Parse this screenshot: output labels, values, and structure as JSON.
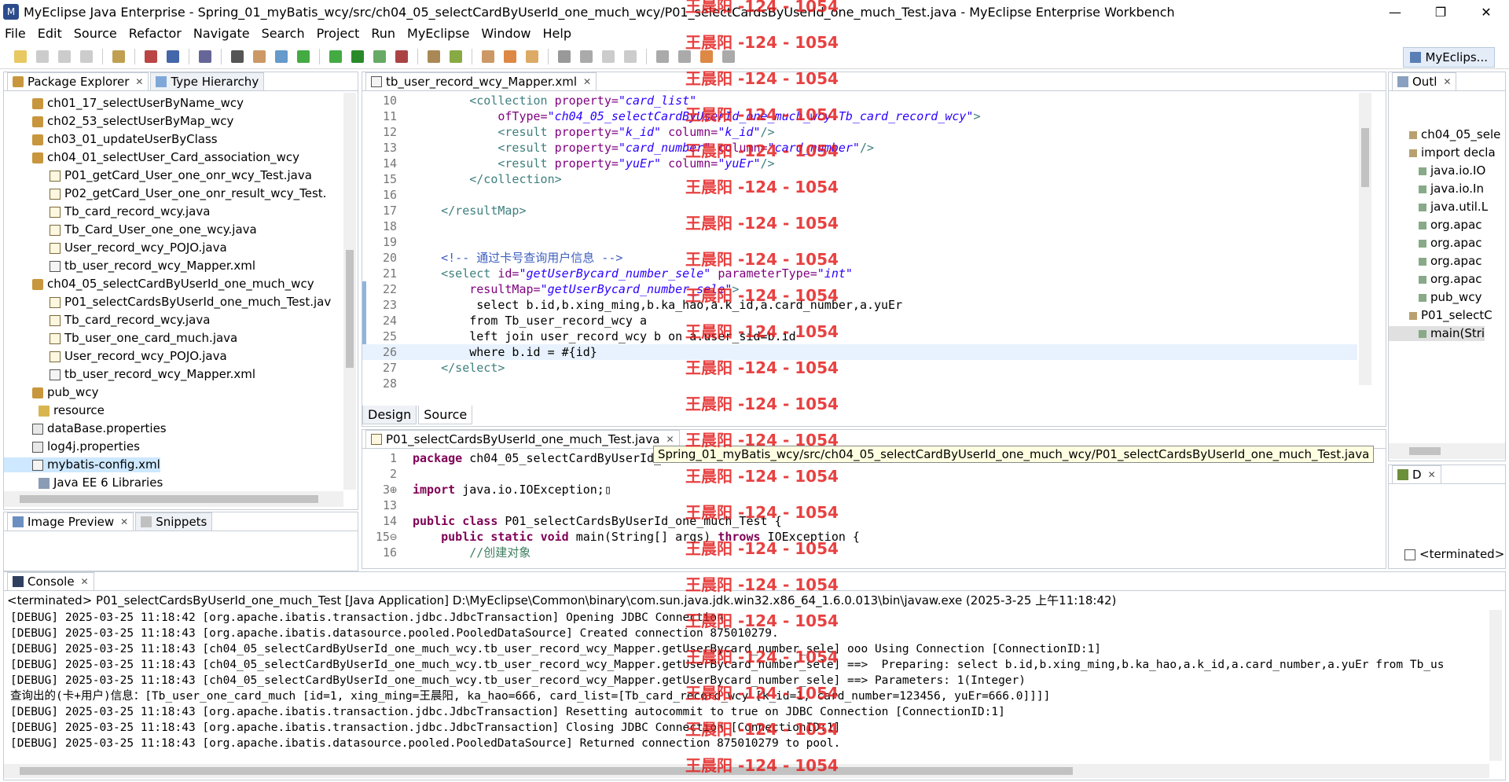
{
  "window": {
    "title": "MyEclipse Java Enterprise - Spring_01_myBatis_wcy/src/ch04_05_selectCardByUserId_one_much_wcy/P01_selectCardsByUserId_one_much_Test.java - MyEclipse Enterprise Workbench",
    "minimize": "—",
    "restore": "❐",
    "close": "✕"
  },
  "menu": [
    "File",
    "Edit",
    "Source",
    "Refactor",
    "Navigate",
    "Search",
    "Project",
    "Run",
    "MyEclipse",
    "Window",
    "Help"
  ],
  "perspective": "MyEclips...",
  "package_explorer": {
    "tab": "Package Explorer",
    "tab2": "Type Hierarchy",
    "items": [
      {
        "label": "ch01_17_selectUserByName_wcy",
        "type": "pkg",
        "indent": 1
      },
      {
        "label": "ch02_53_selectUserByMap_wcy",
        "type": "pkg",
        "indent": 1
      },
      {
        "label": "ch03_01_updateUserByClass",
        "type": "pkg",
        "indent": 1
      },
      {
        "label": "ch04_01_selectUser_Card_association_wcy",
        "type": "pkg",
        "indent": 1
      },
      {
        "label": "P01_getCard_User_one_onr_wcy_Test.java",
        "type": "java",
        "indent": 2
      },
      {
        "label": "P02_getCard_User_one_onr_result_wcy_Test.",
        "type": "java",
        "indent": 2
      },
      {
        "label": "Tb_card_record_wcy.java",
        "type": "java",
        "indent": 2
      },
      {
        "label": "Tb_Card_User_one_one_wcy.java",
        "type": "java",
        "indent": 2
      },
      {
        "label": "User_record_wcy_POJO.java",
        "type": "java",
        "indent": 2
      },
      {
        "label": "tb_user_record_wcy_Mapper.xml",
        "type": "xml",
        "indent": 2
      },
      {
        "label": "ch04_05_selectCardByUserId_one_much_wcy",
        "type": "pkg",
        "indent": 1
      },
      {
        "label": "P01_selectCardsByUserId_one_much_Test.jav",
        "type": "java",
        "indent": 2
      },
      {
        "label": "Tb_card_record_wcy.java",
        "type": "java",
        "indent": 2
      },
      {
        "label": "Tb_user_one_card_much.java",
        "type": "java",
        "indent": 2
      },
      {
        "label": "User_record_wcy_POJO.java",
        "type": "java",
        "indent": 2
      },
      {
        "label": "tb_user_record_wcy_Mapper.xml",
        "type": "xml",
        "indent": 2
      },
      {
        "label": "pub_wcy",
        "type": "pkg",
        "indent": 1
      },
      {
        "label": "resource",
        "type": "folder",
        "indent": 0
      },
      {
        "label": "dataBase.properties",
        "type": "prop",
        "indent": 1
      },
      {
        "label": "log4j.properties",
        "type": "prop",
        "indent": 1
      },
      {
        "label": "mybatis-config.xml",
        "type": "xml",
        "indent": 1,
        "selected": true
      },
      {
        "label": "Java EE 6 Libraries",
        "type": "lib",
        "indent": 0
      }
    ]
  },
  "image_preview": {
    "tab": "Image Preview",
    "tab2": "Snippets"
  },
  "xml_editor": {
    "tab": "tb_user_record_wcy_Mapper.xml",
    "bottom_tabs": [
      "Design",
      "Source"
    ],
    "lines": [
      {
        "n": "10",
        "html": "        <span class='tag'>&lt;collection</span> <span class='attr'>property=</span><span class='str'>\"card_list\"</span>"
      },
      {
        "n": "11",
        "html": "            <span class='attr'>ofType=</span><span class='str'>\"ch04_05_selectCardByUserId_one_much_wcy.Tb_card_record_wcy\"</span><span class='tag'>&gt;</span>"
      },
      {
        "n": "12",
        "html": "            <span class='tag'>&lt;result</span> <span class='attr'>property=</span><span class='str'>\"k_id\"</span> <span class='attr'>column=</span><span class='str'>\"k_id\"</span><span class='tag'>/&gt;</span>"
      },
      {
        "n": "13",
        "html": "            <span class='tag'>&lt;result</span> <span class='attr'>property=</span><span class='str'>\"card_number\"</span> <span class='attr'>column=</span><span class='str'>\"card_number\"</span><span class='tag'>/&gt;</span>"
      },
      {
        "n": "14",
        "html": "            <span class='tag'>&lt;result</span> <span class='attr'>property=</span><span class='str'>\"yuEr\"</span> <span class='attr'>column=</span><span class='str'>\"yuEr\"</span><span class='tag'>/&gt;</span>"
      },
      {
        "n": "15",
        "html": "        <span class='tag'>&lt;/collection&gt;</span>"
      },
      {
        "n": "16",
        "html": ""
      },
      {
        "n": "17",
        "html": "    <span class='tag'>&lt;/resultMap&gt;</span>"
      },
      {
        "n": "18",
        "html": ""
      },
      {
        "n": "19",
        "html": ""
      },
      {
        "n": "20",
        "html": "    <span class='cmt'>&lt;!-- 通过卡号查询用户信息 --&gt;</span>"
      },
      {
        "n": "21",
        "html": "    <span class='tag'>&lt;select</span> <span class='attr'>id=</span><span class='str'>\"getUserBycard_number_sele\"</span> <span class='attr'>parameterType=</span><span class='str'>\"int\"</span>"
      },
      {
        "n": "22",
        "html": "        <span class='attr'>resultMap=</span><span class='str'>\"getUserBycard_number_sele\"</span><span class='tag'>&gt;</span>"
      },
      {
        "n": "23",
        "html": "         select b.id,b.xing_ming,b.ka_hao,a.k_id,a.card_number,a.yuEr"
      },
      {
        "n": "24",
        "html": "        from Tb_user_record_wcy a"
      },
      {
        "n": "25",
        "html": "        left join user_record_wcy b on a.user_sid=b.id"
      },
      {
        "n": "26",
        "html": "        where b.id = #{id}"
      },
      {
        "n": "27",
        "html": "    <span class='tag'>&lt;/select&gt;</span>"
      },
      {
        "n": "28",
        "html": ""
      }
    ]
  },
  "java_editor": {
    "tab": "P01_selectCardsByUserId_one_much_Test.java",
    "tooltip": "Spring_01_myBatis_wcy/src/ch04_05_selectCardByUserId_one_much_wcy/P01_selectCardsByUserId_one_much_Test.java",
    "lines": [
      {
        "n": "1",
        "html": "<span class='kw'>package</span> ch04_05_selectCardByUserId_o"
      },
      {
        "n": "2",
        "html": ""
      },
      {
        "n": "3⊕",
        "html": "<span class='kw'>import</span> java.io.IOException;▯"
      },
      {
        "n": "13",
        "html": ""
      },
      {
        "n": "14",
        "html": "<span class='kw'>public</span> <span class='kw'>class</span> P01_selectCardsByUserId_one_much_Test {"
      },
      {
        "n": "15⊖",
        "html": "    <span class='kw'>public</span> <span class='kw'>static</span> <span class='kw'>void</span> main(String[] args) <span class='kw'>throws</span> IOException {"
      },
      {
        "n": "16",
        "html": "        <span class='gcmt'>//创建对象</span>"
      }
    ]
  },
  "outline": {
    "tab": "Outl",
    "items": [
      {
        "label": "ch04_05_sele",
        "indent": 1
      },
      {
        "label": "import decla",
        "indent": 1
      },
      {
        "label": "java.io.IO",
        "indent": 2
      },
      {
        "label": "java.io.In",
        "indent": 2
      },
      {
        "label": "java.util.L",
        "indent": 2
      },
      {
        "label": "org.apac",
        "indent": 2
      },
      {
        "label": "org.apac",
        "indent": 2
      },
      {
        "label": "org.apac",
        "indent": 2
      },
      {
        "label": "org.apac",
        "indent": 2
      },
      {
        "label": "pub_wcy",
        "indent": 2
      },
      {
        "label": "P01_selectC",
        "indent": 1
      },
      {
        "label": "main(Stri",
        "indent": 2
      }
    ]
  },
  "debug_panel": {
    "tab": "D",
    "terminated": "<terminated>"
  },
  "console": {
    "tab": "Console",
    "header": "<terminated> P01_selectCardsByUserId_one_much_Test [Java Application] D:\\MyEclipse\\Common\\binary\\com.sun.java.jdk.win32.x86_64_1.6.0.013\\bin\\javaw.exe (2025-3-25 上午11:18:42)",
    "lines": [
      "[DEBUG] 2025-03-25 11:18:42 [org.apache.ibatis.transaction.jdbc.JdbcTransaction] Opening JDBC Connection",
      "[DEBUG] 2025-03-25 11:18:43 [org.apache.ibatis.datasource.pooled.PooledDataSource] Created connection 875010279.",
      "[DEBUG] 2025-03-25 11:18:43 [ch04_05_selectCardByUserId_one_much_wcy.tb_user_record_wcy_Mapper.getUserBycard_number_sele] ooo Using Connection [ConnectionID:1]",
      "[DEBUG] 2025-03-25 11:18:43 [ch04_05_selectCardByUserId_one_much_wcy.tb_user_record_wcy_Mapper.getUserBycard_number_sele] ==>  Preparing: select b.id,b.xing_ming,b.ka_hao,a.k_id,a.card_number,a.yuEr from Tb_us",
      "[DEBUG] 2025-03-25 11:18:43 [ch04_05_selectCardByUserId_one_much_wcy.tb_user_record_wcy_Mapper.getUserBycard_number_sele] ==> Parameters: 1(Integer)",
      "查询出的(卡+用户)信息：[Tb_user_one_card_much [id=1, xing_ming=王晨阳, ka_hao=666, card_list=[Tb_card_record_wcy [k_id=1, card_number=123456, yuEr=666.0]]]]",
      "[DEBUG] 2025-03-25 11:18:43 [org.apache.ibatis.transaction.jdbc.JdbcTransaction] Resetting autocommit to true on JDBC Connection [ConnectionID:1]",
      "[DEBUG] 2025-03-25 11:18:43 [org.apache.ibatis.transaction.jdbc.JdbcTransaction] Closing JDBC Connection [ConnectionID:1]",
      "[DEBUG] 2025-03-25 11:18:43 [org.apache.ibatis.datasource.pooled.PooledDataSource] Returned connection 875010279 to pool."
    ]
  },
  "watermark": "王晨阳 -124 - 1054",
  "colors": {
    "accent": "#2b4b8c",
    "selection": "#cde8ff",
    "watermark": "#e52020",
    "cursor_line": "#e8f2fe"
  }
}
